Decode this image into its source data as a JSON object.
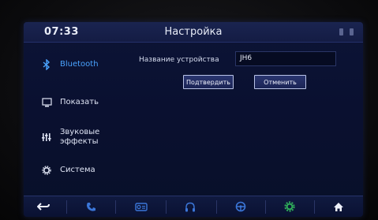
{
  "status_bar": {
    "time": "07:33",
    "title": "Настройка"
  },
  "sidebar": {
    "items": [
      {
        "label": "Bluetooth",
        "icon": "bluetooth-icon",
        "active": true
      },
      {
        "label": "Показать",
        "icon": "display-icon",
        "active": false
      },
      {
        "label": "Звуковые\nэффекты",
        "icon": "equalizer-icon",
        "active": false
      },
      {
        "label": "Система",
        "icon": "gear-icon",
        "active": false
      }
    ]
  },
  "content": {
    "device_name_label": "Название устройства",
    "device_name_value": "JH6",
    "confirm_label": "Подтвердить",
    "cancel_label": "Отменить"
  },
  "dock": {
    "items": [
      "back-icon",
      "phone-icon",
      "radio-icon",
      "headphones-icon",
      "steering-wheel-icon",
      "settings-icon",
      "home-icon"
    ]
  },
  "colors": {
    "accent": "#4aa3ff",
    "dock_icon": "#3b76d8",
    "settings_active": "#2fae5a"
  }
}
